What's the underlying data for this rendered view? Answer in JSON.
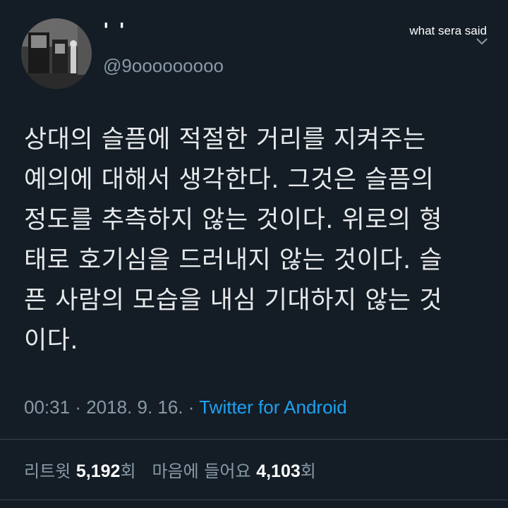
{
  "user": {
    "display_name": "' '",
    "handle": "@9ooooooooo",
    "avatar_icon": "avatar-photo"
  },
  "watermark": "what sera said",
  "tweet": {
    "lines": [
      "상대의 슬픔에 적절한 거리를 지켜주는",
      "예의에 대해서 생각한다. 그것은 슬픔의",
      "정도를 추측하지 않는 것이다. 위로의 형",
      "태로 호기심을 드러내지 않는 것이다. 슬",
      "픈 사람의 모습을 내심 기대하지 않는 것",
      "이다."
    ]
  },
  "meta": {
    "time": "00:31",
    "separator": "·",
    "date": "2018. 9. 16.",
    "client": "Twitter for Android"
  },
  "stats": {
    "retweets_label": "리트윗",
    "retweets_count": "5,192",
    "retweets_unit": "회",
    "likes_label": "마음에 들어요",
    "likes_count": "4,103",
    "likes_unit": "회"
  },
  "colors": {
    "background": "#141d26",
    "text": "#e7e9ea",
    "muted": "#8899a6",
    "link": "#1da1f2",
    "divider": "#38444d"
  }
}
